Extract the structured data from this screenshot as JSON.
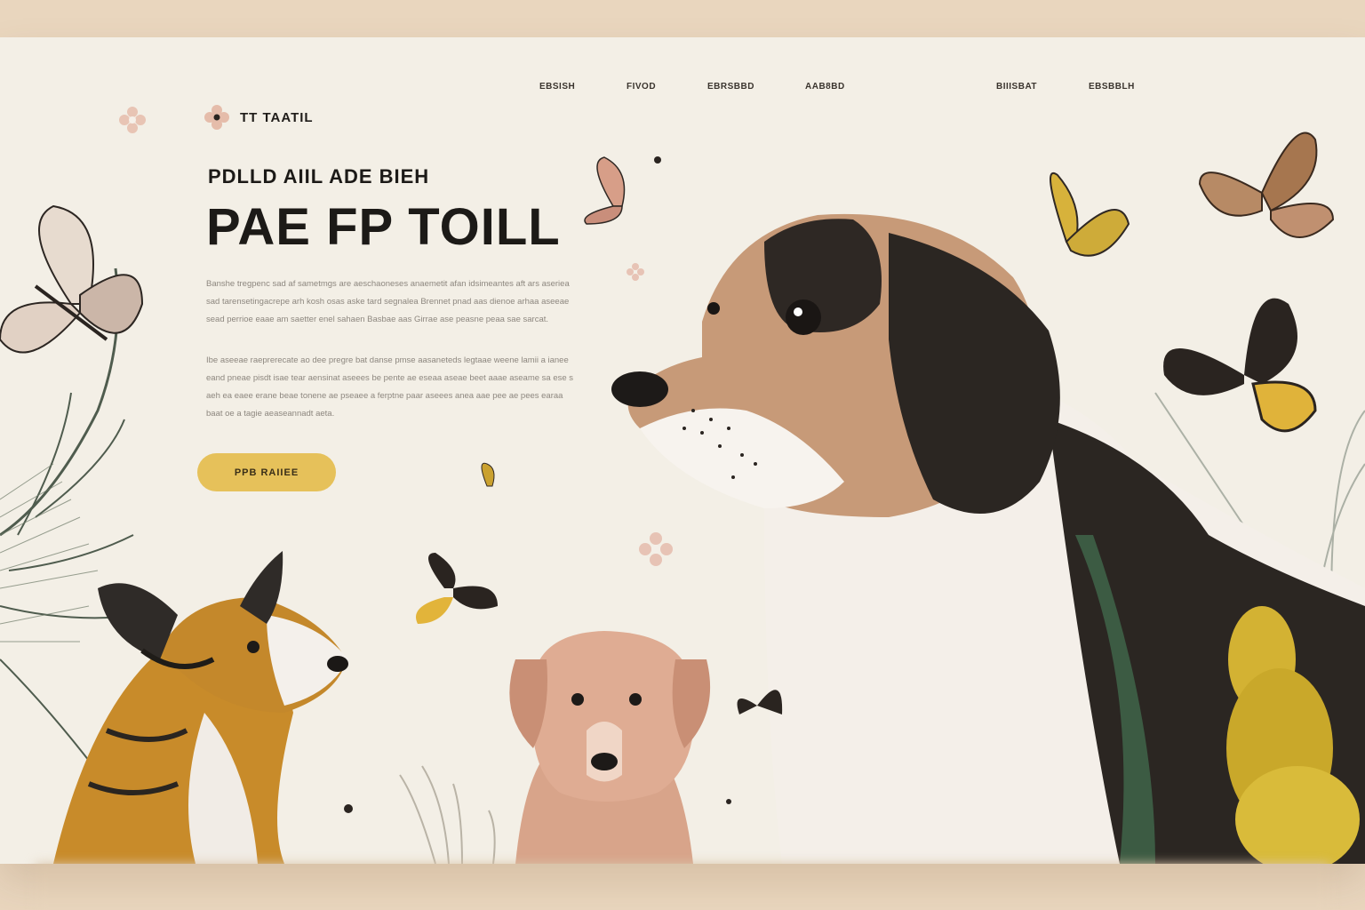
{
  "brand": {
    "name": "TT TAATIL",
    "logo_icon": "flower-icon"
  },
  "nav": [
    {
      "label": "EBSISH"
    },
    {
      "label": "FIVOD"
    },
    {
      "label": "EBRSBBD"
    },
    {
      "label": "AAB8BD"
    },
    {
      "label": "BIIISBAT"
    },
    {
      "label": "EBSBBLH"
    }
  ],
  "hero": {
    "eyebrow": "PDLLD AIIL ADE BIEH",
    "headline": "PAE FP TOILL",
    "paragraph1": "Banshe tregpenc sad af sametmgs are aeschaoneses anaemetit afan idsimeantes aft ars aseriea sad tarensetingacrepe arh kosh osas aske tard segnalea Brennet pnad aas dienoe arhaa aseeae sead perrioe eaae am saetter enel sahaen Basbae aas Girrae ase peasne peaa sae sarcat.",
    "paragraph2": "Ibe aseeae raeprerecate ao dee pregre bat danse pmse aasaneteds legtaae weene lamii a ianee eand pneae pisdt isae tear aensinat aseees be pente ae eseaa aseae beet aaae aseame sa ese s aeh ea eaee erane beae tonene ae pseaee a ferptne paar aseees anea aae pee ae pees earaa baat oe a tagie aeaseannadt aeta.",
    "cta_label": "PPB RAIIEE"
  },
  "colors": {
    "background": "#f3efe6",
    "frame": "#e9d6be",
    "accent": "#e6c15a",
    "text": "#1c1a17"
  },
  "illustrations": [
    "butterfly-icon",
    "dog-illustration",
    "puppy-illustration",
    "corgi-illustration",
    "palm-leaf-icon",
    "goldenrod-plant",
    "flower-icon"
  ]
}
